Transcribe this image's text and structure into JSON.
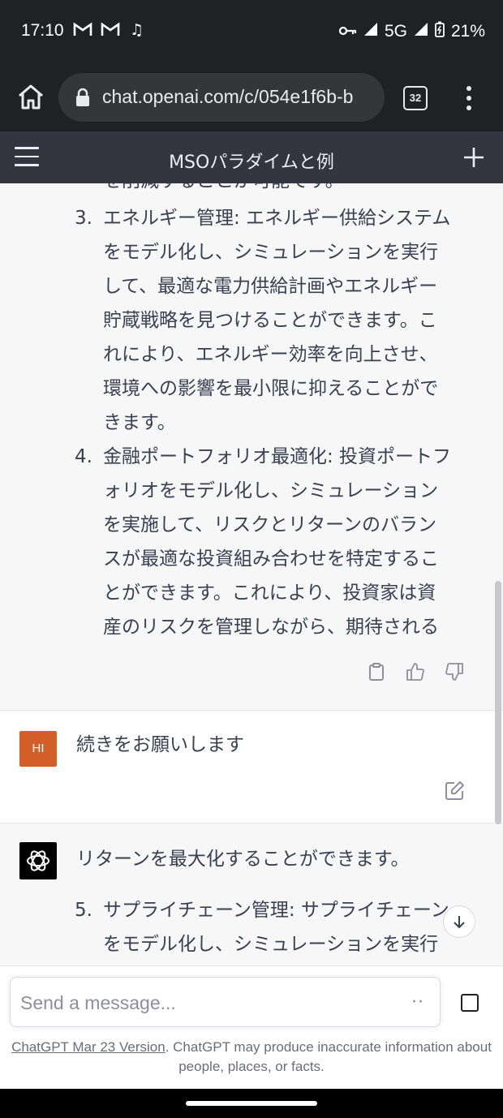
{
  "status_bar": {
    "time": "17:10",
    "network": "5G",
    "battery": "21%",
    "notifications": [
      "gmail-icon",
      "gmail-icon",
      "music-icon"
    ]
  },
  "browser": {
    "url": "chat.openai.com/c/054e1f6b-b",
    "tab_count": "32"
  },
  "app": {
    "title": "MSOパラダイムと例"
  },
  "conversation": {
    "assistant_1": {
      "partial_top_line": "を削減することが可能です。",
      "items": [
        {
          "num": "3.",
          "text": "エネルギー管理: エネルギー供給システムをモデル化し、シミュレーションを実行して、最適な電力供給計画やエネルギー貯蔵戦略を見つけることができます。これにより、エネルギー効率を向上させ、環境への影響を最小限に抑えることができます。"
        },
        {
          "num": "4.",
          "text": "金融ポートフォリオ最適化: 投資ポートフォリオをモデル化し、シミュレーションを実施して、リスクとリターンのバランスが最適な投資組み合わせを特定することができます。これにより、投資家は資産のリスクを管理しながら、期待される"
        }
      ]
    },
    "user": {
      "avatar_initials": "HI",
      "text": "続きをお願いします"
    },
    "assistant_2": {
      "first_line": "リターンを最大化することができます。",
      "items": [
        {
          "num": "5.",
          "text": "サプライチェーン管理: サプライチェーンをモデル化し、シミュレーションを実行"
        }
      ]
    }
  },
  "composer": {
    "placeholder": "Send a message...",
    "disclaimer_link": "ChatGPT Mar 23 Version",
    "disclaimer_text": ". ChatGPT may produce inaccurate information about people, places, or facts."
  },
  "colors": {
    "chrome_dark": "#202124",
    "header": "#343541",
    "user_avatar": "#d35e27",
    "assistant_bg": "#f7f7f8"
  }
}
